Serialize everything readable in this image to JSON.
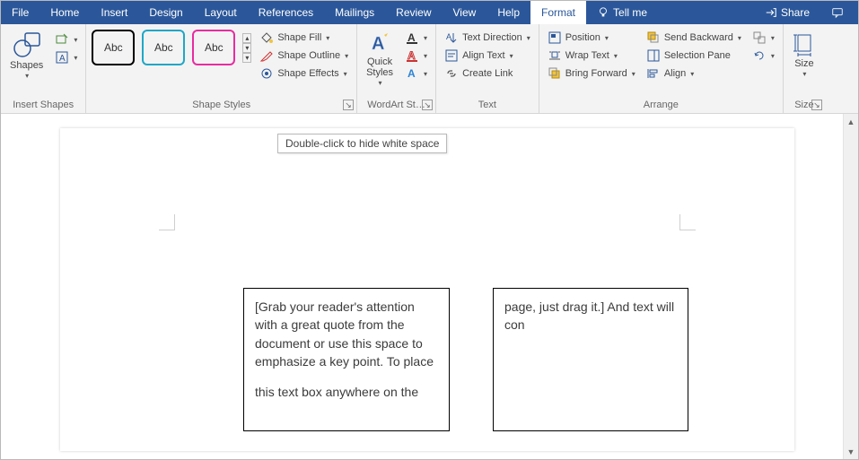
{
  "tabs": {
    "file": "File",
    "home": "Home",
    "insert": "Insert",
    "design": "Design",
    "layout": "Layout",
    "references": "References",
    "mailings": "Mailings",
    "review": "Review",
    "view": "View",
    "help": "Help",
    "format": "Format",
    "tell_me": "Tell me",
    "share": "Share"
  },
  "ribbon": {
    "insert_shapes": {
      "label": "Insert Shapes",
      "shapes_btn": "Shapes"
    },
    "shape_styles": {
      "label": "Shape Styles",
      "preset": "Abc",
      "shape_fill": "Shape Fill",
      "shape_outline": "Shape Outline",
      "shape_effects": "Shape Effects"
    },
    "wordart": {
      "label": "WordArt St…",
      "quick_styles": "Quick\nStyles"
    },
    "text": {
      "label": "Text",
      "text_direction": "Text Direction",
      "align_text": "Align Text",
      "create_link": "Create Link"
    },
    "arrange": {
      "label": "Arrange",
      "position": "Position",
      "wrap_text": "Wrap Text",
      "bring_forward": "Bring Forward",
      "send_backward": "Send Backward",
      "selection_pane": "Selection Pane",
      "align": "Align"
    },
    "size": {
      "label": "Size",
      "size_btn": "Size"
    }
  },
  "tooltip": "Double-click to hide white space",
  "doc": {
    "box1_p1": "[Grab your reader's attention with a great quote from the document or use this space to emphasize a key point. To place",
    "box1_p2": "this text box anywhere on the",
    "box2": "page, just drag it.] And text will con"
  }
}
